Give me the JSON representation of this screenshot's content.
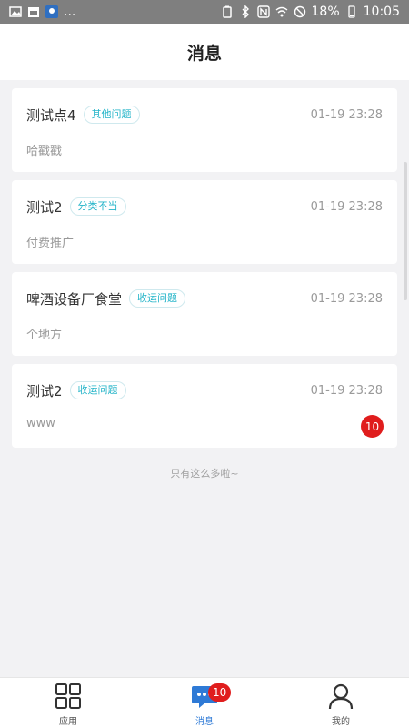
{
  "status_bar": {
    "left_text": "...",
    "battery": "18%",
    "time": "10:05"
  },
  "header": {
    "title": "消息"
  },
  "messages": [
    {
      "name": "测试点4",
      "tag": "其他问题",
      "time": "01-19 23:28",
      "desc": "哈戳戳",
      "badge": ""
    },
    {
      "name": "测试2",
      "tag": "分类不当",
      "time": "01-19 23:28",
      "desc": "付费推广",
      "badge": ""
    },
    {
      "name": "啤酒设备厂食堂",
      "tag": "收运问题",
      "time": "01-19 23:28",
      "desc": "个地方",
      "badge": ""
    },
    {
      "name": "测试2",
      "tag": "收运问题",
      "time": "01-19 23:28",
      "desc": "www",
      "badge": "10"
    }
  ],
  "footer_note": "只有这么多啦~",
  "tabbar": {
    "items": [
      {
        "label": "应用",
        "icon": "grid-icon"
      },
      {
        "label": "消息",
        "icon": "chat-icon",
        "badge": "10"
      },
      {
        "label": "我的",
        "icon": "user-icon"
      }
    ]
  },
  "colors": {
    "accent": "#2e7ad6",
    "tag": "#26b5c9",
    "badge": "#e01d1d",
    "background": "#f2f2f4"
  }
}
